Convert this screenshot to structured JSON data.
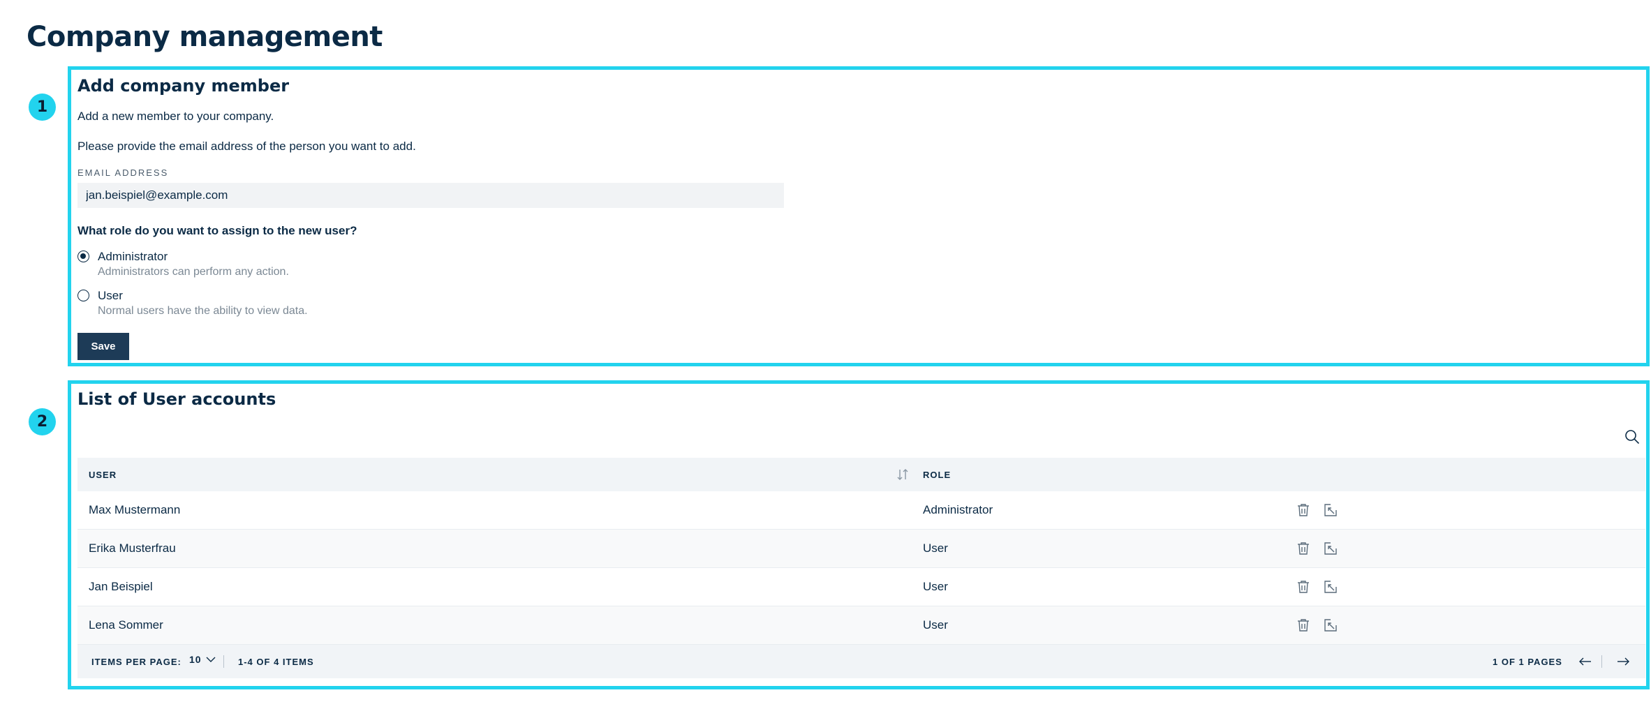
{
  "page": {
    "title": "Company management"
  },
  "markers": [
    "1",
    "2"
  ],
  "add_member": {
    "title": "Add company member",
    "intro_1": "Add a new member to your company.",
    "intro_2": "Please provide the email address of the person you want to add.",
    "email_label": "EMAIL ADDRESS",
    "email_value": "jan.beispiel@example.com",
    "role_question": "What role do you want to assign to the new user?",
    "roles": [
      {
        "label": "Administrator",
        "description": "Administrators can perform any action.",
        "selected": true
      },
      {
        "label": "User",
        "description": "Normal users have the ability to view data.",
        "selected": false
      }
    ],
    "save_label": "Save"
  },
  "user_list": {
    "title": "List of User accounts",
    "columns": {
      "user": "USER",
      "role": "ROLE"
    },
    "rows": [
      {
        "user": "Max Mustermann",
        "role": "Administrator"
      },
      {
        "user": "Erika Musterfrau",
        "role": "User"
      },
      {
        "user": "Jan Beispiel",
        "role": "User"
      },
      {
        "user": "Lena Sommer",
        "role": "User"
      }
    ],
    "footer": {
      "items_per_page_label": "ITEMS PER PAGE:",
      "items_per_page_value": "10",
      "range": "1-4 OF 4 ITEMS",
      "pages": "1 OF 1 PAGES"
    }
  },
  "colors": {
    "accent": "#22d3ee",
    "primary": "#1d3b57",
    "text": "#0b2a45"
  },
  "icons": [
    "search-icon",
    "sort-icon",
    "trash-icon",
    "edit-icon",
    "chevron-down-icon",
    "arrow-left-icon",
    "arrow-right-icon"
  ]
}
